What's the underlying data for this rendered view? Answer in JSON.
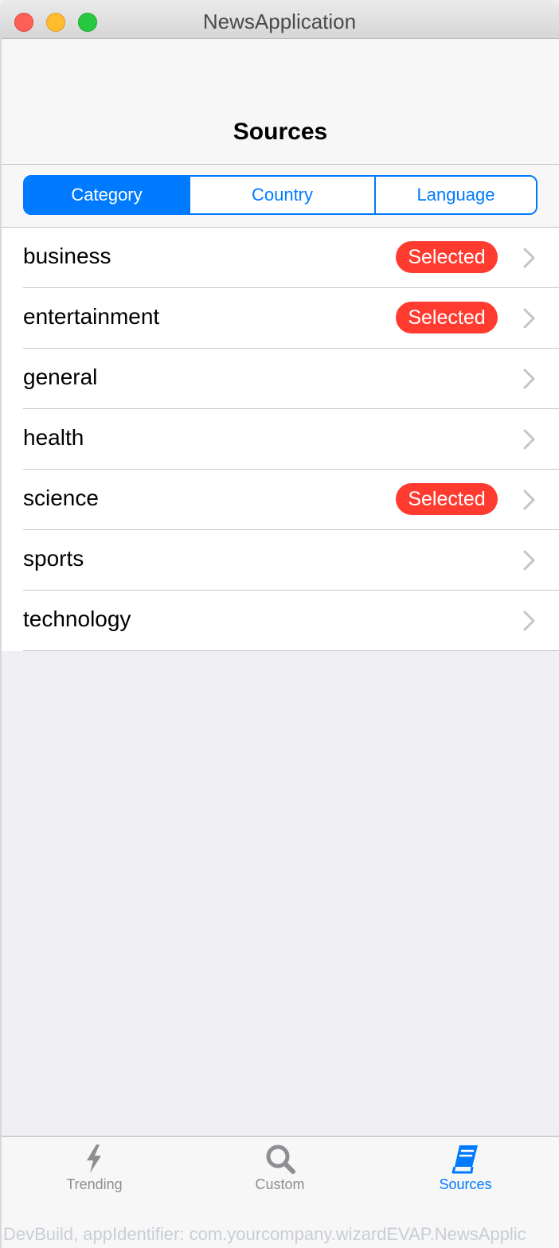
{
  "window": {
    "title": "NewsApplication"
  },
  "navbar": {
    "title": "Sources"
  },
  "segments": [
    {
      "label": "Category",
      "selected": true
    },
    {
      "label": "Country",
      "selected": false
    },
    {
      "label": "Language",
      "selected": false
    }
  ],
  "categories": [
    {
      "label": "business",
      "badge": "Selected"
    },
    {
      "label": "entertainment",
      "badge": "Selected"
    },
    {
      "label": "general",
      "badge": null
    },
    {
      "label": "health",
      "badge": null
    },
    {
      "label": "science",
      "badge": "Selected"
    },
    {
      "label": "sports",
      "badge": null
    },
    {
      "label": "technology",
      "badge": null
    }
  ],
  "tabbar": {
    "items": [
      {
        "label": "Trending",
        "icon": "bolt-icon",
        "active": false
      },
      {
        "label": "Custom",
        "icon": "search-icon",
        "active": false
      },
      {
        "label": "Sources",
        "icon": "book-icon",
        "active": true
      }
    ]
  },
  "footer": {
    "text": "DevBuild, appIdentifier: com.yourcompany.wizardEVAP.NewsApplic"
  },
  "colors": {
    "accent": "#007aff",
    "badge": "#ff3b30",
    "inactive_tab": "#8e8e93",
    "background": "#efeff4"
  }
}
